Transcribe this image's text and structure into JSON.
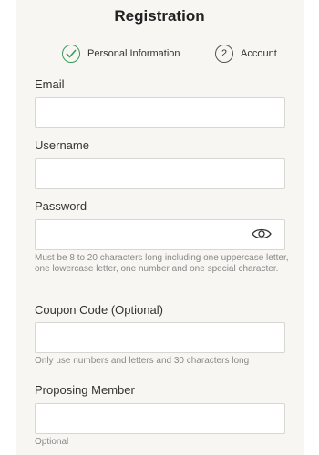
{
  "header": {
    "title": "Registration"
  },
  "steps": [
    {
      "number": "",
      "label": "Personal Information",
      "state": "done"
    },
    {
      "number": "2",
      "label": "Account",
      "state": "todo"
    }
  ],
  "form": {
    "email": {
      "label": "Email",
      "value": ""
    },
    "username": {
      "label": "Username",
      "value": ""
    },
    "password": {
      "label": "Password",
      "value": "",
      "hint": "Must be 8 to 20 characters long including one uppercase letter, one lowercase letter, one number and one special character."
    },
    "coupon": {
      "label": "Coupon Code (Optional)",
      "value": "",
      "hint": "Only use numbers and letters and 30 characters long"
    },
    "proposing_member": {
      "label": "Proposing Member",
      "value": "",
      "hint": "Optional"
    }
  },
  "icons": {
    "step_done": "check-circle-icon",
    "password_toggle": "eye-icon"
  },
  "colors": {
    "panel_background": "#f7f6f3",
    "check_green": "#3a9a5a",
    "hint_gray": "#888888"
  }
}
